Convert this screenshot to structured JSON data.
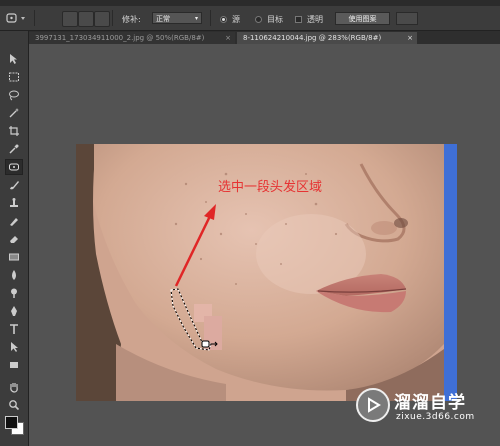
{
  "optionsBar": {
    "patchLabel": "修补:",
    "patchMode": "正常",
    "sourceLabel": "源",
    "destLabel": "目标",
    "transparentLabel": "透明",
    "usePatternLabel": "使用图案"
  },
  "tabs": [
    {
      "title": "3997131_173034911000_2.jpg @ 50%(RGB/8#)",
      "close": "×"
    },
    {
      "title": "8-110624210044.jpg @ 283%(RGB/8#)",
      "close": "×"
    }
  ],
  "annotation": "选中一段头发区域",
  "watermark": {
    "name": "溜溜自学",
    "url": "zixue.3d66.com"
  }
}
